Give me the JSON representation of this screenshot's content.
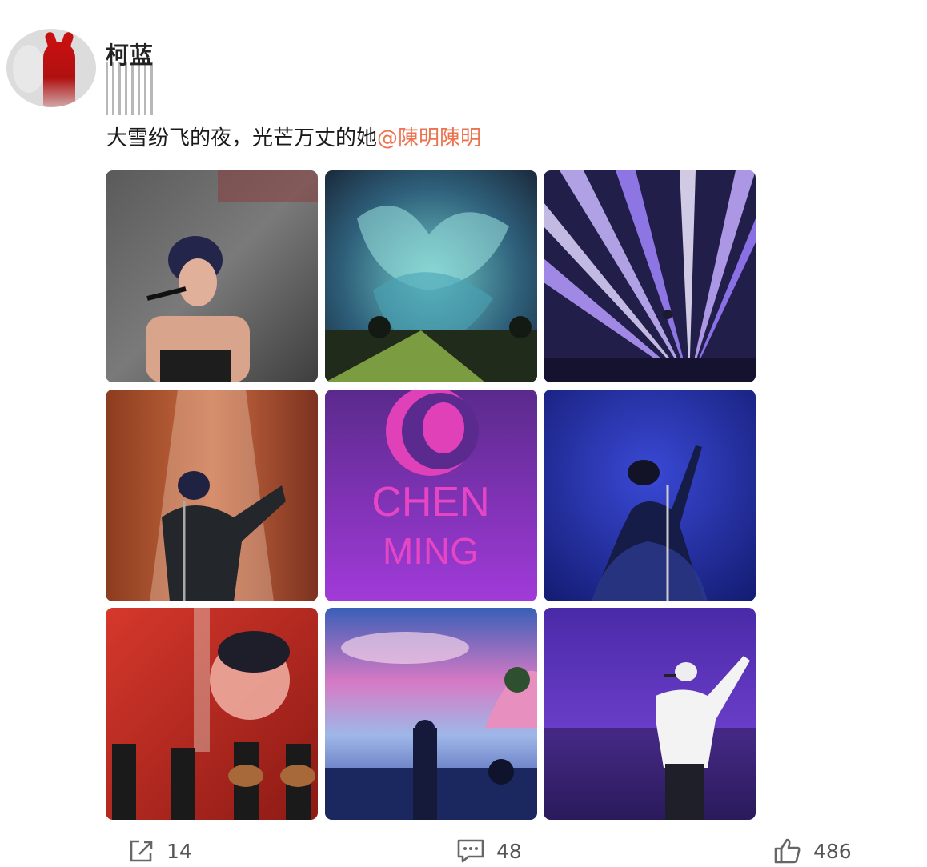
{
  "post": {
    "author": "柯蓝",
    "text": "大雪纷飞的夜，光芒万丈的她",
    "mention": "@陳明陳明"
  },
  "images": [
    {
      "id": "photo-singer-black-dress",
      "palette": "gray"
    },
    {
      "id": "photo-stage-floral-screen",
      "palette": "teal"
    },
    {
      "id": "photo-laser-beams",
      "palette": "violet"
    },
    {
      "id": "photo-singer-spotlight-orange",
      "palette": "orange"
    },
    {
      "id": "logo-chen-ming",
      "palette": "purple",
      "logo_line1": "CHEN",
      "logo_line2": "MING"
    },
    {
      "id": "photo-singer-blue-gown",
      "palette": "blue"
    },
    {
      "id": "photo-band-red-screen",
      "palette": "red"
    },
    {
      "id": "photo-singer-seaside-screen",
      "palette": "pink"
    },
    {
      "id": "photo-singer-white-shirt",
      "palette": "indigo"
    }
  ],
  "actions": {
    "share_count": "14",
    "comment_count": "48",
    "like_count": "486"
  },
  "colors": {
    "mention": "#eb7350",
    "text": "#1a1a1a",
    "muted": "#555555"
  },
  "icons": {
    "share": "share-icon",
    "comment": "comment-icon",
    "like": "thumbs-up-icon"
  }
}
